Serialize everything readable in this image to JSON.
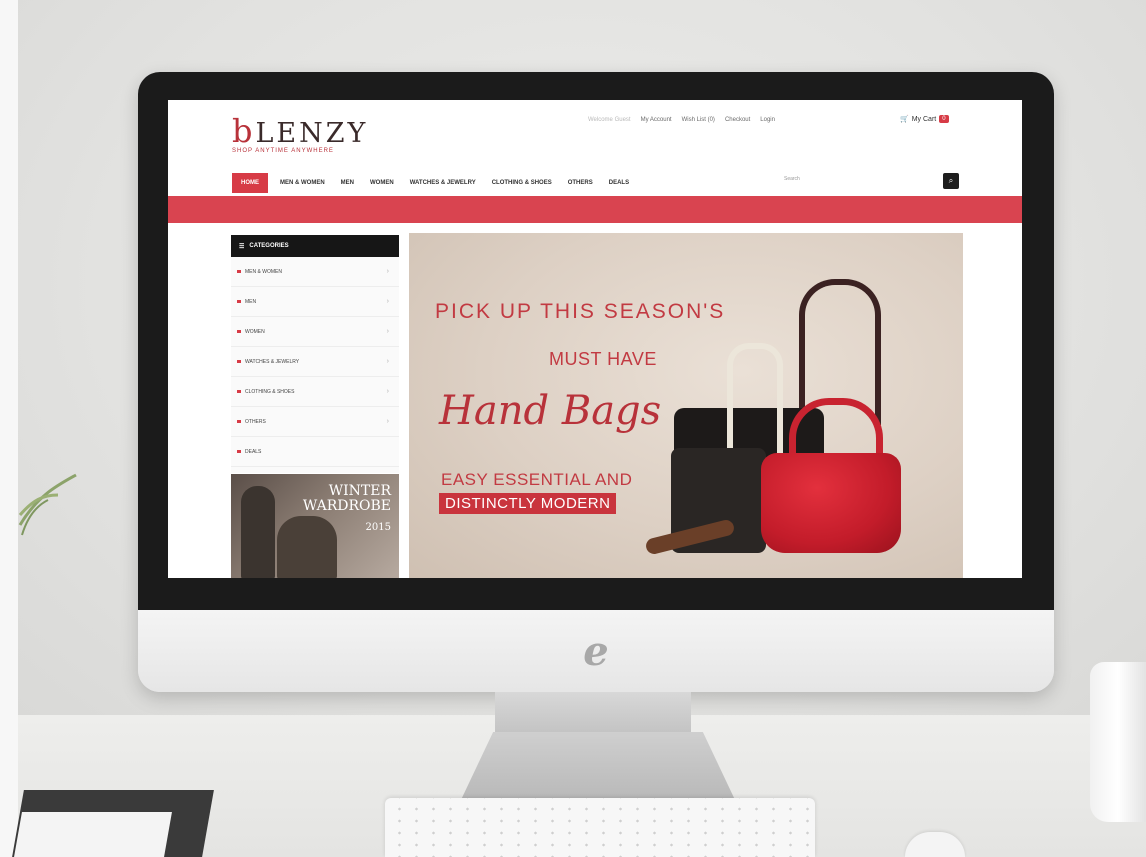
{
  "site": {
    "logo_text": "LENZY",
    "logo_b": "b",
    "tagline": "SHOP ANYTIME ANYWHERE"
  },
  "top_links": [
    "Welcome Guest",
    "My Account",
    "Wish List (0)",
    "Checkout",
    "Login"
  ],
  "cart_label": "My Cart",
  "cart_count": "0",
  "nav": {
    "items": [
      "HOME",
      "MEN & WOMEN",
      "MEN",
      "WOMEN",
      "WATCHES & JEWELRY",
      "CLOTHING & SHOES",
      "OTHERS",
      "DEALS"
    ],
    "search_placeholder": "Search",
    "search_icon": "search-icon"
  },
  "sidebar": {
    "heading": "CATEGORIES",
    "items": [
      "MEN & WOMEN",
      "MEN",
      "WOMEN",
      "WATCHES & JEWELRY",
      "CLOTHING & SHOES",
      "OTHERS",
      "DEALS"
    ]
  },
  "promo": {
    "line1": "WINTER",
    "line2": "WARDROBE",
    "year": "2015"
  },
  "banner": {
    "line1": "PICK UP THIS SEASON'S",
    "line2": "MUST HAVE",
    "line3": "Hand Bags",
    "line4": "EASY ESSENTIAL AND",
    "line5": "DISTINCTLY MODERN"
  },
  "colors": {
    "accent": "#d73b46",
    "dark": "#161616",
    "banner_bg": "#ddd0c4"
  }
}
